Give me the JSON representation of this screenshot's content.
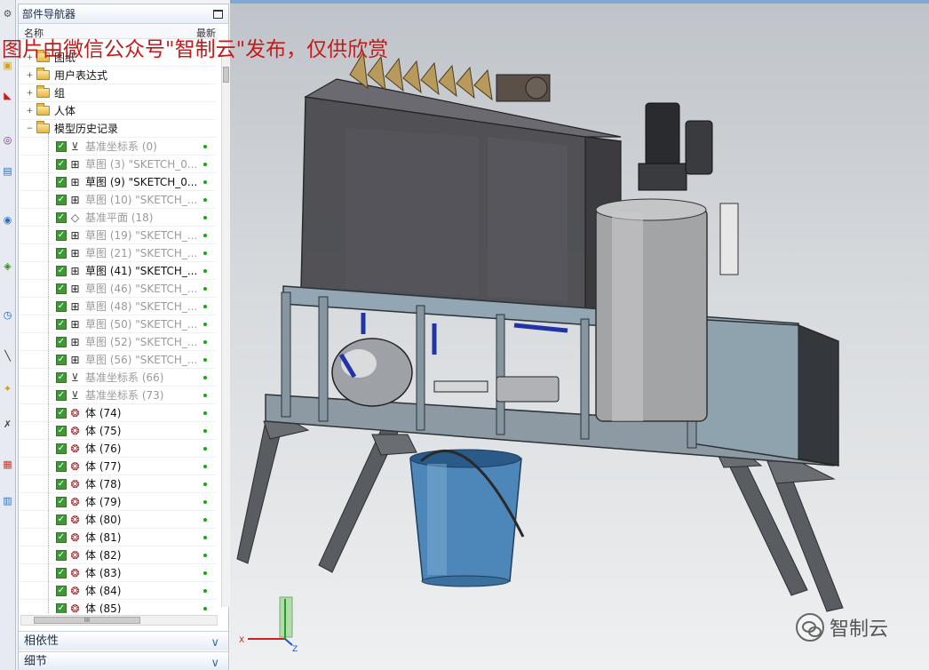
{
  "navigator": {
    "title": "部件导航器",
    "col_name": "名称",
    "col_latest": "最新",
    "scroll_glyph": "III",
    "rows": [
      {
        "label": "图纸",
        "kind": "folder",
        "depth": 1,
        "exp": "+",
        "style": "norm"
      },
      {
        "label": "用户表达式",
        "kind": "folder",
        "depth": 1,
        "exp": "+",
        "style": "norm"
      },
      {
        "label": "组",
        "kind": "folder",
        "depth": 1,
        "exp": "+",
        "style": "norm"
      },
      {
        "label": "人体",
        "kind": "folder",
        "depth": 1,
        "exp": "+",
        "style": "norm"
      },
      {
        "label": "模型历史记录",
        "kind": "folder",
        "depth": 1,
        "exp": "−",
        "style": "norm"
      },
      {
        "label": "基准坐标系 (0)",
        "kind": "csys",
        "depth": 2,
        "style": "dim"
      },
      {
        "label": "草图 (3) \"SKETCH_0...",
        "kind": "sketch",
        "depth": 2,
        "style": "dim"
      },
      {
        "label": "草图 (9) \"SKETCH_0...",
        "kind": "sketch",
        "depth": 2,
        "style": "norm"
      },
      {
        "label": "草图 (10) \"SKETCH_...",
        "kind": "sketch",
        "depth": 2,
        "style": "dim"
      },
      {
        "label": "基准平面 (18)",
        "kind": "plane",
        "depth": 2,
        "style": "dim"
      },
      {
        "label": "草图 (19) \"SKETCH_...",
        "kind": "sketch",
        "depth": 2,
        "style": "dim"
      },
      {
        "label": "草图 (21) \"SKETCH_...",
        "kind": "sketch",
        "depth": 2,
        "style": "dim"
      },
      {
        "label": "草图 (41) \"SKETCH_...",
        "kind": "sketch",
        "depth": 2,
        "style": "norm"
      },
      {
        "label": "草图 (46) \"SKETCH_...",
        "kind": "sketch",
        "depth": 2,
        "style": "dim"
      },
      {
        "label": "草图 (48) \"SKETCH_...",
        "kind": "sketch",
        "depth": 2,
        "style": "dim"
      },
      {
        "label": "草图 (50) \"SKETCH_...",
        "kind": "sketch",
        "depth": 2,
        "style": "dim"
      },
      {
        "label": "草图 (52) \"SKETCH_...",
        "kind": "sketch",
        "depth": 2,
        "style": "dim"
      },
      {
        "label": "草图 (56) \"SKETCH_...",
        "kind": "sketch",
        "depth": 2,
        "style": "dim"
      },
      {
        "label": "基准坐标系 (66)",
        "kind": "csys",
        "depth": 2,
        "style": "dim"
      },
      {
        "label": "基准坐标系 (73)",
        "kind": "csys",
        "depth": 2,
        "style": "dim"
      },
      {
        "label": "体 (74)",
        "kind": "body",
        "depth": 2,
        "style": "norm"
      },
      {
        "label": "体 (75)",
        "kind": "body",
        "depth": 2,
        "style": "norm"
      },
      {
        "label": "体 (76)",
        "kind": "body",
        "depth": 2,
        "style": "norm"
      },
      {
        "label": "体 (77)",
        "kind": "body",
        "depth": 2,
        "style": "norm"
      },
      {
        "label": "体 (78)",
        "kind": "body",
        "depth": 2,
        "style": "norm"
      },
      {
        "label": "体 (79)",
        "kind": "body",
        "depth": 2,
        "style": "norm"
      },
      {
        "label": "体 (80)",
        "kind": "body",
        "depth": 2,
        "style": "norm"
      },
      {
        "label": "体 (81)",
        "kind": "body",
        "depth": 2,
        "style": "norm"
      },
      {
        "label": "体 (82)",
        "kind": "body",
        "depth": 2,
        "style": "norm"
      },
      {
        "label": "体 (83)",
        "kind": "body",
        "depth": 2,
        "style": "norm"
      },
      {
        "label": "体 (84)",
        "kind": "body",
        "depth": 2,
        "style": "norm"
      },
      {
        "label": "体 (85)",
        "kind": "body",
        "depth": 2,
        "style": "norm"
      }
    ],
    "sections": [
      {
        "label": "相依性"
      },
      {
        "label": "细节"
      }
    ]
  },
  "overlay_text": "图片由微信公众号\"智制云\"发布，仅供欣赏",
  "watermark_text": "智制云",
  "axis_labels": {
    "x": "X",
    "z": "Z"
  },
  "colors": {
    "overlay_red": "#c51a1a",
    "check_green": "#3c9a35",
    "frame_blue_gray": "#93a6b3",
    "pipe_blue": "#2233aa"
  },
  "icons": {
    "csys": "datum-csys-icon",
    "sketch": "sketch-icon",
    "plane": "datum-plane-icon",
    "body": "body-icon",
    "folder": "folder-icon"
  }
}
